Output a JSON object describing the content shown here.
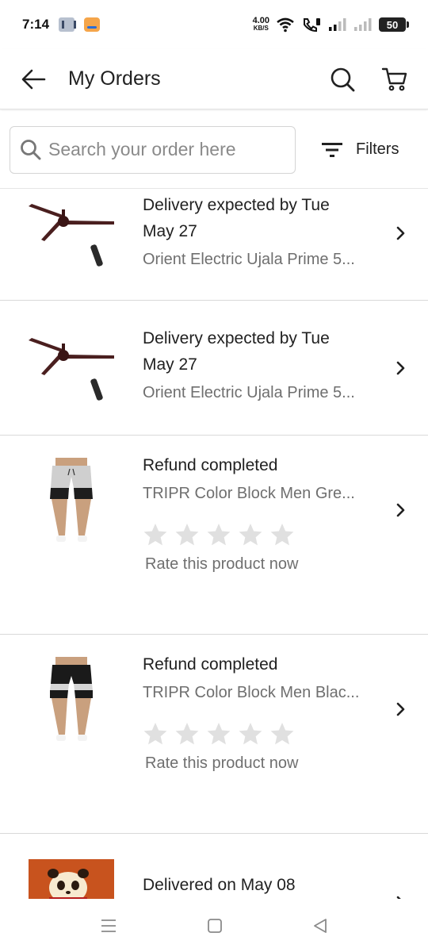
{
  "status_bar": {
    "time": "7:14",
    "speed_value": "4.00",
    "speed_unit": "KB/S",
    "battery": "50"
  },
  "header": {
    "title": "My Orders"
  },
  "search": {
    "placeholder": "Search your order here",
    "filters_label": "Filters"
  },
  "orders": [
    {
      "status_line1": "Delivery expected by Tue",
      "status_line2": "May 27",
      "product": "Orient Electric Ujala Prime 5...",
      "image": "ceiling-fan"
    },
    {
      "status_line1": "Delivery expected by Tue",
      "status_line2": "May 27",
      "product": "Orient Electric Ujala Prime 5...",
      "image": "ceiling-fan"
    },
    {
      "status_line1": "Refund completed",
      "product": "TRIPR Color Block Men Gre...",
      "rating_prompt": "Rate this product now",
      "image": "grey-shorts"
    },
    {
      "status_line1": "Refund completed",
      "product": "TRIPR Color Block Men Blac...",
      "rating_prompt": "Rate this product now",
      "image": "black-shorts"
    },
    {
      "status_line1": "Delivered on May 08",
      "image": "panda-lamp"
    }
  ],
  "colors": {
    "text_primary": "#212121",
    "text_secondary": "#6f6f6f",
    "star_empty": "#e0e0e0",
    "divider": "#d9d9d9"
  }
}
